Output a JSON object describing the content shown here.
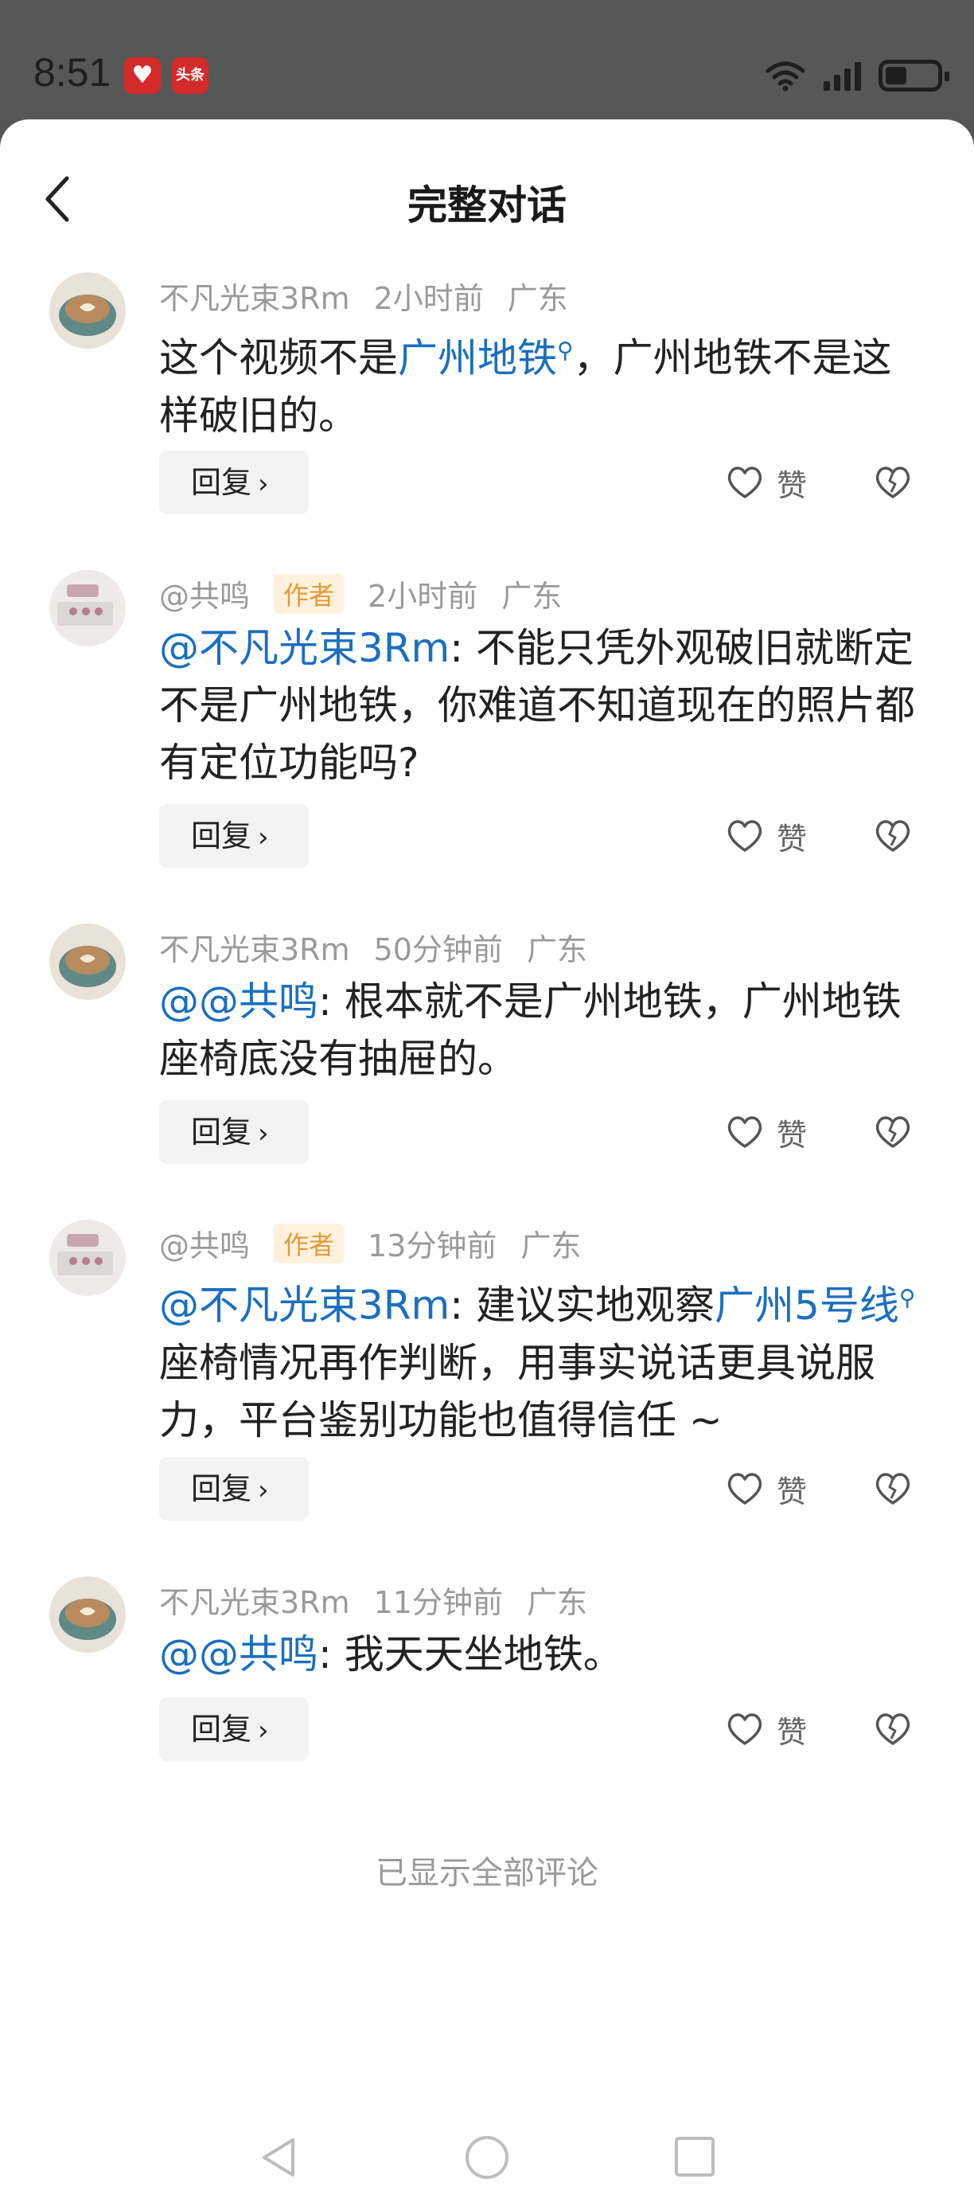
{
  "status_bar": {
    "time": "8:51",
    "apps": [
      "heart-app-icon",
      "toutiao-app-icon"
    ],
    "toutiao_label": "头条",
    "icons": [
      "wifi-icon",
      "signal-icon",
      "battery-icon"
    ]
  },
  "header": {
    "title": "完整对话"
  },
  "comments": [
    {
      "user": "不凡光束3Rm",
      "is_author": false,
      "time": "2小时前",
      "location": "广东",
      "segments": [
        {
          "text": "这个视频不是",
          "type": "text"
        },
        {
          "text": "广州地铁",
          "type": "link"
        },
        {
          "text": "，广州地铁不是这样破旧的。",
          "type": "text"
        }
      ],
      "reply_label": "回复",
      "like_label": "赞"
    },
    {
      "user": "@共鸣",
      "is_author": true,
      "author_label": "作者",
      "time": "2小时前",
      "location": "广东",
      "segments": [
        {
          "text": "@不凡光束3Rm",
          "type": "mention"
        },
        {
          "text": ": 不能只凭外观破旧就断定不是广州地铁，你难道不知道现在的照片都有定位功能吗?",
          "type": "text"
        }
      ],
      "reply_label": "回复",
      "like_label": "赞"
    },
    {
      "user": "不凡光束3Rm",
      "is_author": false,
      "time": "50分钟前",
      "location": "广东",
      "segments": [
        {
          "text": "@@共鸣",
          "type": "mention"
        },
        {
          "text": ": 根本就不是广州地铁，广州地铁座椅底没有抽屉的。",
          "type": "text"
        }
      ],
      "reply_label": "回复",
      "like_label": "赞"
    },
    {
      "user": "@共鸣",
      "is_author": true,
      "author_label": "作者",
      "time": "13分钟前",
      "location": "广东",
      "segments": [
        {
          "text": "@不凡光束3Rm",
          "type": "mention"
        },
        {
          "text": ": 建议实地观察",
          "type": "text"
        },
        {
          "text": "广州5号线",
          "type": "link"
        },
        {
          "text": " 座椅情况再作判断，用事实说话更具说服力，平台鉴别功能也值得信任 ~",
          "type": "text"
        }
      ],
      "reply_label": "回复",
      "like_label": "赞"
    },
    {
      "user": "不凡光束3Rm",
      "is_author": false,
      "time": "11分钟前",
      "location": "广东",
      "segments": [
        {
          "text": "@@共鸣",
          "type": "mention"
        },
        {
          "text": ": 我天天坐地铁。",
          "type": "text"
        }
      ],
      "reply_label": "回复",
      "like_label": "赞"
    }
  ],
  "footer": {
    "end_note": "已显示全部评论"
  },
  "nav": [
    "nav-back-icon",
    "nav-home-icon",
    "nav-recent-icon"
  ],
  "colors": {
    "link": "#1a6fbf",
    "author_tag_text": "#e39a3a",
    "author_tag_bg": "#fff1dc",
    "meta": "#9a9a9a",
    "status_bar_bg": "#575757"
  }
}
